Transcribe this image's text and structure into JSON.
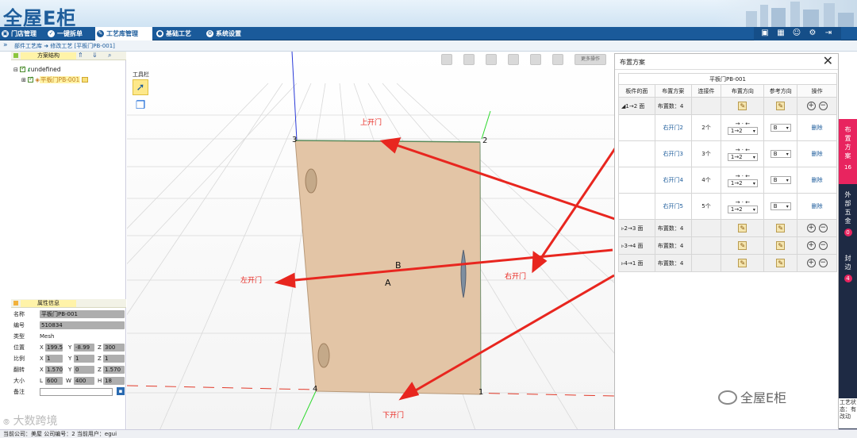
{
  "header": {
    "logo_text": "全屋E柜",
    "nav": [
      {
        "label": "门店管理",
        "icon": "store-icon"
      },
      {
        "label": "一键拆单",
        "icon": "check-icon"
      },
      {
        "label": "工艺库管理",
        "icon": "craft-icon",
        "active": true
      },
      {
        "label": "基础工艺",
        "icon": "base-icon"
      },
      {
        "label": "系统设置",
        "icon": "settings-icon"
      }
    ],
    "toolbar_icons": [
      "screen-icon",
      "calendar-icon",
      "user-icon",
      "gear-icon",
      "logout-icon"
    ]
  },
  "breadcrumb": "部件工艺库 ➜ 修改工艺 [平板门PB-001]",
  "left_panel": {
    "tree_title": "方案结构",
    "tree": [
      {
        "label": "undefined"
      },
      {
        "label": "平板门PB-001",
        "selected": true
      }
    ],
    "toolbox_label": "工具栏",
    "props_title": "属性信息",
    "props": {
      "name_label": "名称",
      "name_value": "平板门PB-001",
      "code_label": "编号",
      "code_value": "510834",
      "type_label": "类型",
      "type_value": "Mesh",
      "pos_label": "位置",
      "pos_x": "199.5",
      "pos_y": "-8.99",
      "pos_z": "300",
      "scale_label": "比例",
      "scale_x": "1",
      "scale_y": "1",
      "scale_z": "1",
      "rot_label": "翻转",
      "rot_x": "1.570",
      "rot_y": "0",
      "rot_z": "1.570",
      "size_label": "大小",
      "size_l": "600",
      "size_w": "400",
      "size_h": "18",
      "note_label": "备注",
      "note_value": ""
    }
  },
  "viewport": {
    "more_ops": "更多操作",
    "vertices": [
      "1",
      "2",
      "3",
      "4"
    ],
    "face_labels": [
      "A",
      "B"
    ],
    "annotations": {
      "top": "上开门",
      "bottom": "下开门",
      "left": "左开门",
      "right": "右开门"
    },
    "door_color": "#e3c5a6"
  },
  "right_panel": {
    "title": "布置方案",
    "table_title": "平板门PB-001",
    "headers": [
      "板件的面",
      "布置方案",
      "连接件",
      "布置方向",
      "参考方向",
      "操作"
    ],
    "groups": [
      {
        "face": "1→2 面",
        "count": "布置数：4",
        "expanded": true
      },
      {
        "face": "2→3 面",
        "count": "布置数：4"
      },
      {
        "face": "3→4 面",
        "count": "布置数：4"
      },
      {
        "face": "4→1 面",
        "count": "布置数：4"
      }
    ],
    "rows": [
      {
        "name": "右开门2",
        "parts": "2个",
        "dir": "1→2",
        "ref": "B",
        "action": "删除"
      },
      {
        "name": "右开门3",
        "parts": "3个",
        "dir": "1→2",
        "ref": "B",
        "action": "删除"
      },
      {
        "name": "右开门4",
        "parts": "4个",
        "dir": "1→2",
        "ref": "B",
        "action": "删除"
      },
      {
        "name": "右开门5",
        "parts": "5个",
        "dir": "1→2",
        "ref": "B",
        "action": "删除"
      }
    ],
    "dir_arrows": "→ ⋅ ←"
  },
  "side_tabs": [
    {
      "label": "布置方案",
      "count": "16",
      "color": "#e8245f"
    },
    {
      "label": "外部五金",
      "count": "0",
      "color": "#1e2a44"
    },
    {
      "label": "封边",
      "count": "4",
      "color": "#1e2a44"
    }
  ],
  "side_status": "工艺状态：有改动",
  "statusbar": "当前公司：美屋   公司编号：2   当前用户：egui",
  "watermark": {
    "left": "大数跨境",
    "right": "全屋E柜"
  }
}
